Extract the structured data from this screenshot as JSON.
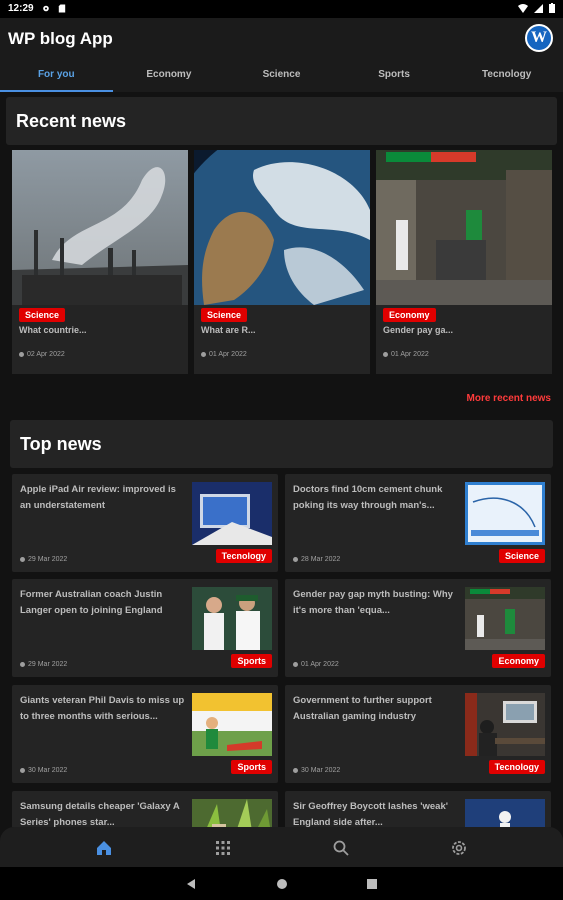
{
  "status_bar": {
    "time": "12:29"
  },
  "app": {
    "title": "WP blog App",
    "logo_letter": "W"
  },
  "tabs": [
    {
      "label": "For you",
      "active": true
    },
    {
      "label": "Economy"
    },
    {
      "label": "Science"
    },
    {
      "label": "Sports"
    },
    {
      "label": "Tecnology"
    }
  ],
  "recent": {
    "heading": "Recent news",
    "more_link": "More recent news",
    "items": [
      {
        "category": "Science",
        "title": "What countrie...",
        "date": "02 Apr 2022",
        "image": "factory-smoke"
      },
      {
        "category": "Science",
        "title": "What are R...",
        "date": "01 Apr 2022",
        "image": "earth-from-space"
      },
      {
        "category": "Economy",
        "title": "Gender pay ga...",
        "date": "01 Apr 2022",
        "image": "supermarket"
      }
    ]
  },
  "top": {
    "heading": "Top news",
    "items": [
      {
        "title": "Apple iPad Air review: improved is an understatement",
        "category": "Tecnology",
        "date": "29 Mar 2022",
        "image": "ipad"
      },
      {
        "title": "Doctors find 10cm cement chunk poking its way through man's...",
        "category": "Science",
        "date": "28 Mar 2022",
        "image": "xray-chart"
      },
      {
        "title": "Former Australian coach Justin Langer open to joining England",
        "category": "Sports",
        "date": "29 Mar 2022",
        "image": "cricket-team"
      },
      {
        "title": "Gender pay gap myth busting: Why it's more than 'equa...",
        "category": "Economy",
        "date": "01 Apr 2022",
        "image": "supermarket"
      },
      {
        "title": "Giants veteran Phil Davis to miss up to three months with serious...",
        "category": "Sports",
        "date": "30 Mar 2022",
        "image": "football"
      },
      {
        "title": "Government to further support Australian gaming industry",
        "category": "Tecnology",
        "date": "30 Mar 2022",
        "image": "gamer-desk"
      },
      {
        "title": "Samsung details cheaper 'Galaxy A Series' phones star...",
        "category": "",
        "date": "",
        "image": "plants"
      },
      {
        "title": "Sir Geoffrey Boycott lashes 'weak' England side after...",
        "category": "",
        "date": "",
        "image": "cricket-field"
      }
    ]
  },
  "colors": {
    "accent": "#4a90e2",
    "badge": "#e00000",
    "link": "#ff3b3b",
    "card": "#242424",
    "background": "#121212"
  },
  "bottom_nav": [
    "home-icon",
    "grid-icon",
    "search-icon",
    "settings-icon"
  ]
}
